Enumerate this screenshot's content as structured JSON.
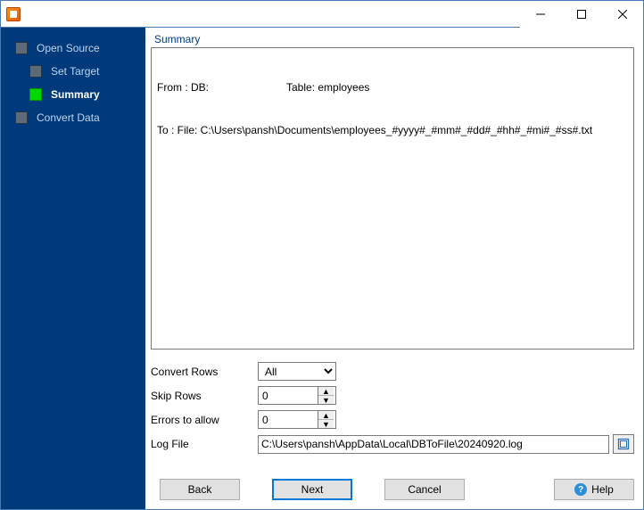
{
  "sidebar": {
    "items": [
      {
        "label": "Open Source",
        "active": false,
        "sub": false
      },
      {
        "label": "Set Target",
        "active": false,
        "sub": true
      },
      {
        "label": "Summary",
        "active": true,
        "sub": true
      },
      {
        "label": "Convert Data",
        "active": false,
        "sub": false
      }
    ]
  },
  "main": {
    "section_title": "Summary",
    "summary_from_label": "From : DB:",
    "summary_table_label": "Table: employees",
    "summary_to_line": "To : File: C:\\Users\\pansh\\Documents\\employees_#yyyy#_#mm#_#dd#_#hh#_#mi#_#ss#.txt"
  },
  "form": {
    "convert_rows_label": "Convert Rows",
    "convert_rows_value": "All",
    "skip_rows_label": "Skip Rows",
    "skip_rows_value": "0",
    "errors_label": "Errors to allow",
    "errors_value": "0",
    "logfile_label": "Log File",
    "logfile_value": "C:\\Users\\pansh\\AppData\\Local\\DBToFile\\20240920.log"
  },
  "buttons": {
    "back": "Back",
    "next": "Next",
    "cancel": "Cancel",
    "help": "Help"
  }
}
